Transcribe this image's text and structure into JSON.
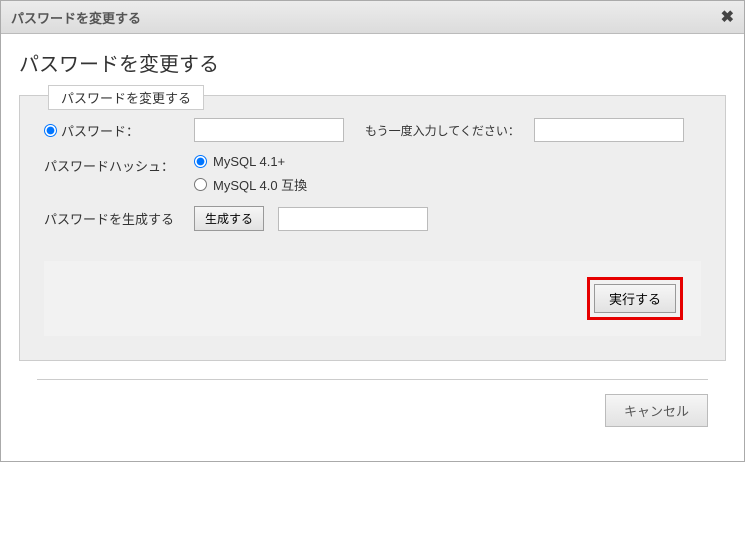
{
  "dialog": {
    "title": "パスワードを変更する",
    "close_label": "✖"
  },
  "page": {
    "heading": "パスワードを変更する",
    "fieldset_legend": "パスワードを変更する"
  },
  "form": {
    "password_label": "パスワード：",
    "password_value": "",
    "reenter_label": "もう一度入力してください：",
    "reenter_value": "",
    "hash_label": "パスワードハッシュ：",
    "hash_options": {
      "opt1": "MySQL 4.1+",
      "opt2": "MySQL 4.0 互換"
    },
    "generate_label": "パスワードを生成する",
    "generate_btn": "生成する",
    "generated_value": ""
  },
  "buttons": {
    "go": "実行する",
    "cancel": "キャンセル"
  }
}
